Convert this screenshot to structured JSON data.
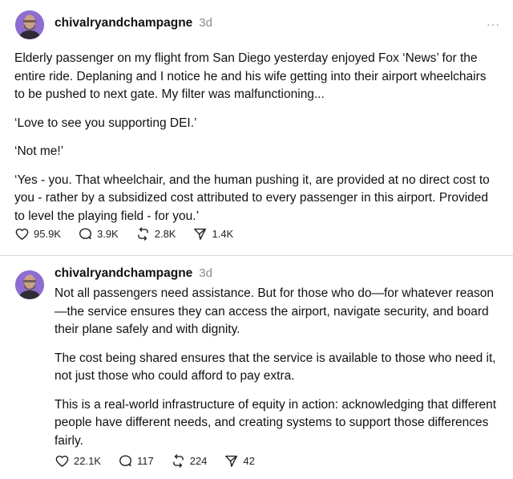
{
  "posts": [
    {
      "username": "chivalryandchampagne",
      "time": "3d",
      "more": "···",
      "paragraphs": [
        "Elderly passenger on my flight from San Diego yesterday enjoyed Fox ‘News’ for the entire ride. Deplaning and I notice he and his wife getting into their airport wheelchairs to be pushed to next gate. My filter was malfunctioning...",
        "‘Love to see you supporting DEI.’",
        "‘Not me!’",
        "‘Yes - you. That wheelchair, and the human pushing it, are provided at no direct cost to you - rather by a subsidized cost attributed to every passenger in this airport. Provided to level the playing field - for you.’"
      ],
      "likes": "95.9K",
      "replies": "3.9K",
      "reposts": "2.8K",
      "shares": "1.4K"
    },
    {
      "username": "chivalryandchampagne",
      "time": "3d",
      "paragraphs": [
        "Not all passengers need assistance. But for those who do—for whatever reason—the service ensures they can access the airport, navigate security, and board their plane safely and with dignity.",
        "The cost being shared ensures that the service is available to those who need it, not just those who could afford to pay extra.",
        "This is a real-world infrastructure of equity in action: acknowledging that different people have different needs, and creating systems to support those differences fairly."
      ],
      "likes": "22.1K",
      "replies": "117",
      "reposts": "224",
      "shares": "42"
    }
  ],
  "colors": {
    "avatar_bg": "#8e6dd0",
    "meta": "#8a8a8a",
    "divider": "#d9d9d9"
  },
  "icons": [
    "heart-icon",
    "comment-icon",
    "repost-icon",
    "share-icon",
    "more-icon"
  ]
}
